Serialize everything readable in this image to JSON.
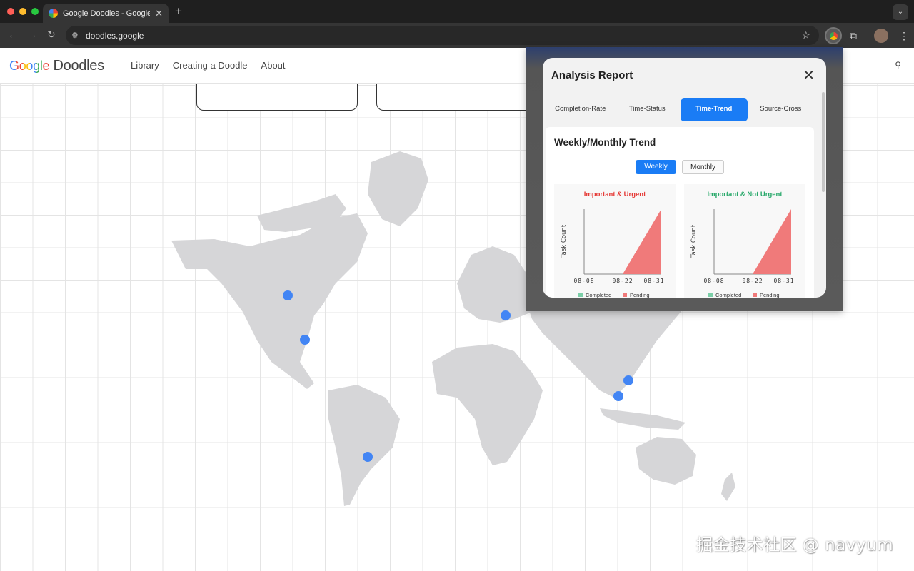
{
  "browser": {
    "tab_title": "Google Doodles - Google's S",
    "url": "doodles.google"
  },
  "site": {
    "logo_google": "Google",
    "logo_doodles": "Doodles",
    "nav": [
      "Library",
      "Creating a Doodle",
      "About"
    ]
  },
  "report": {
    "title": "Analysis Report",
    "tabs": [
      "Completion-Rate",
      "Time-Status",
      "Time-Trend",
      "Source-Cross"
    ],
    "active_tab": "Time-Trend",
    "section_title": "Weekly/Monthly Trend",
    "toggle_weekly": "Weekly",
    "toggle_monthly": "Monthly"
  },
  "chart_data": [
    {
      "type": "area",
      "title": "Important & Urgent",
      "title_color": "#e53935",
      "ylabel": "Task Count",
      "x": [
        "08-08",
        "08-22",
        "08-31"
      ],
      "series": [
        {
          "name": "Completed",
          "color": "#7ccfa8",
          "values": [
            0,
            0,
            0
          ]
        },
        {
          "name": "Pending",
          "color": "#f07a7a",
          "values": [
            0,
            0,
            1
          ]
        }
      ],
      "legend": "bottom"
    },
    {
      "type": "area",
      "title": "Important & Not Urgent",
      "title_color": "#26a869",
      "ylabel": "Task Count",
      "x": [
        "08-08",
        "08-22",
        "08-31"
      ],
      "series": [
        {
          "name": "Completed",
          "color": "#7ccfa8",
          "values": [
            0,
            0,
            0
          ]
        },
        {
          "name": "Pending",
          "color": "#f07a7a",
          "values": [
            0,
            0,
            1
          ]
        }
      ],
      "legend": "bottom"
    }
  ],
  "watermark": "掘金技术社区 @ navyum"
}
